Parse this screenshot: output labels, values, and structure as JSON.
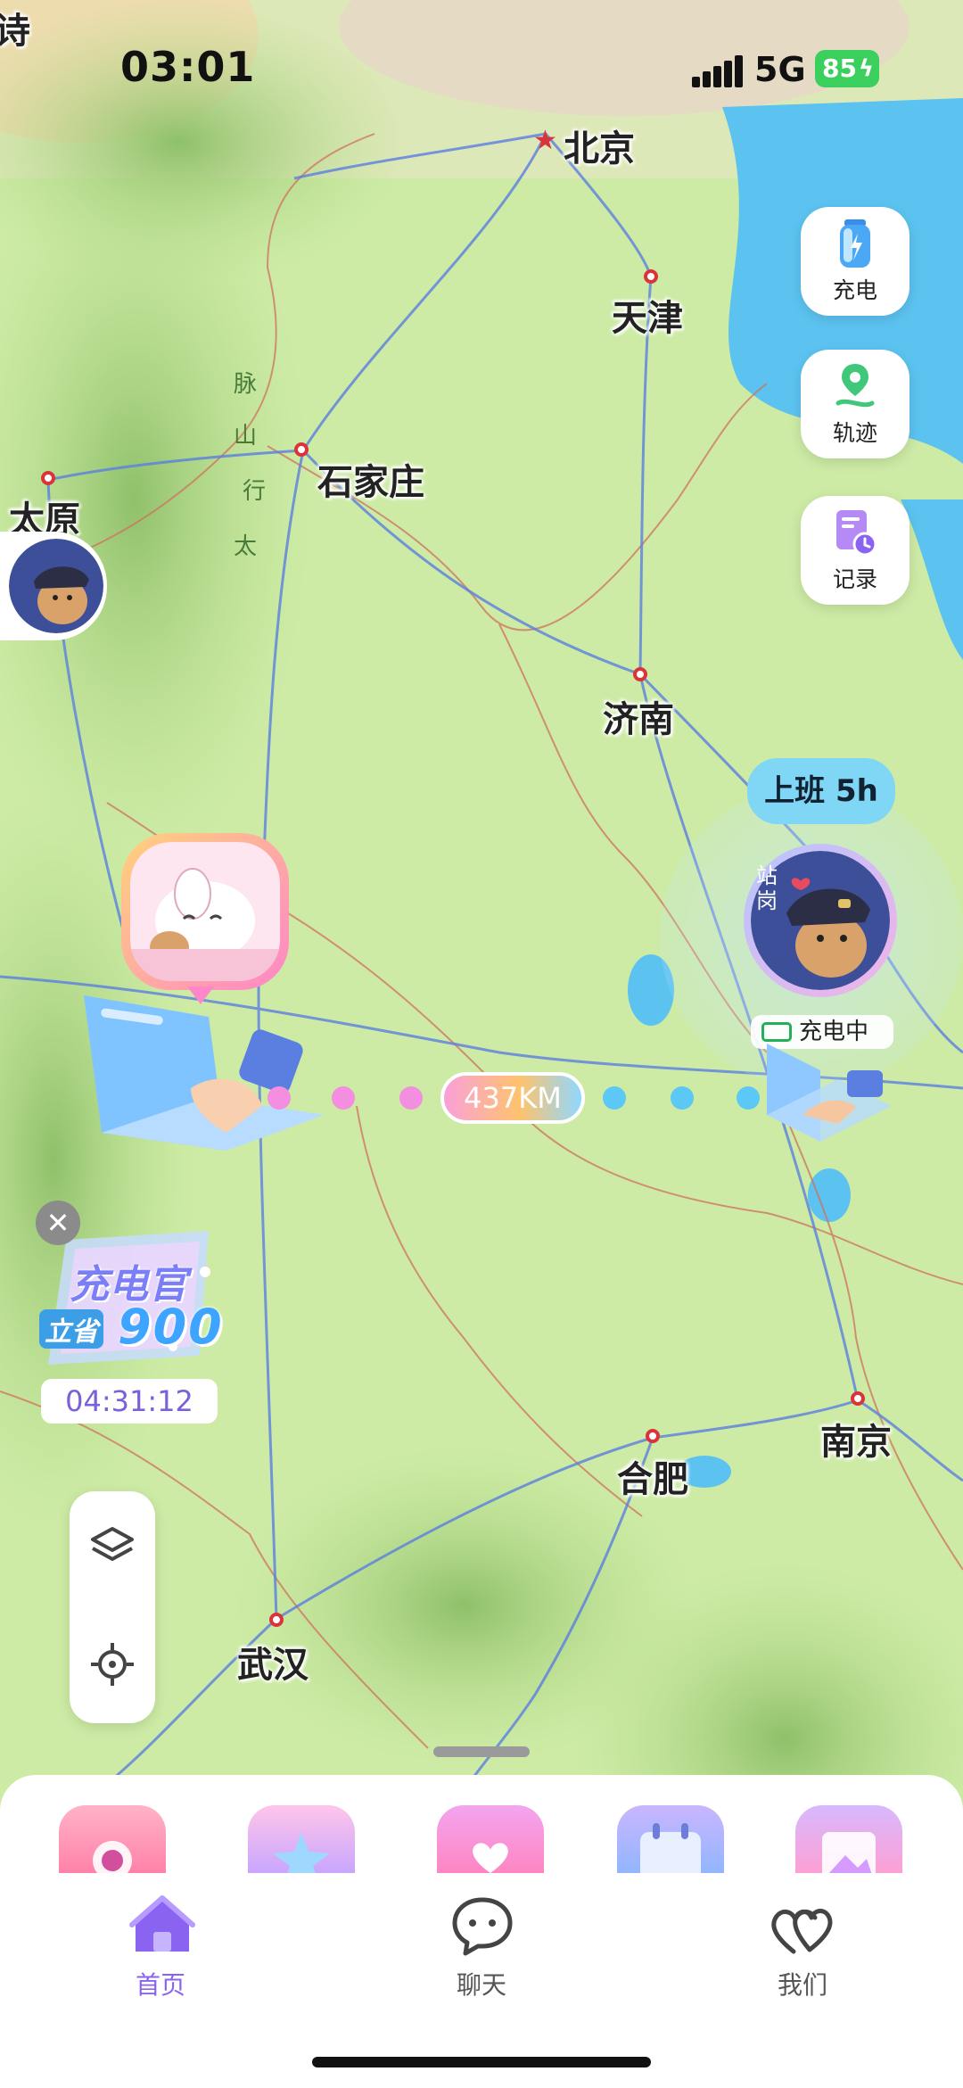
{
  "status_bar": {
    "time": "03:01",
    "network": "5G",
    "battery": "85"
  },
  "map": {
    "cities": [
      {
        "id": "beijing",
        "name": "北京",
        "capital": true
      },
      {
        "id": "tianjin",
        "name": "天津"
      },
      {
        "id": "taiyuan",
        "name": "太原"
      },
      {
        "id": "shijiazhuang",
        "name": "石家庄"
      },
      {
        "id": "jinan",
        "name": "济南"
      },
      {
        "id": "nanjing",
        "name": "南京"
      },
      {
        "id": "hefei",
        "name": "合肥"
      },
      {
        "id": "wuhan",
        "name": "武汉"
      }
    ],
    "mountain_label": [
      "太",
      "行",
      "山",
      "脉"
    ],
    "edge_glyph": "诗"
  },
  "side_buttons": [
    {
      "label": "充电",
      "icon": "charge-icon"
    },
    {
      "label": "轨迹",
      "icon": "track-icon"
    },
    {
      "label": "记录",
      "icon": "record-icon"
    }
  ],
  "partner": {
    "status": "上班 5h",
    "charging": "充电中"
  },
  "distance": "437KM",
  "promo": {
    "title": "充电官",
    "prefix": "立省",
    "amount": "900",
    "countdown": "04:31:12"
  },
  "bottom_apps": [
    "camera-icon",
    "star-icon",
    "heart-card-icon",
    "calendar-icon",
    "photos-icon"
  ],
  "tabs": [
    {
      "label": "首页",
      "icon": "home-icon",
      "active": true
    },
    {
      "label": "聊天",
      "icon": "chat-icon",
      "active": false
    },
    {
      "label": "我们",
      "icon": "hearts-icon",
      "active": false
    }
  ],
  "colors": {
    "accent": "#8a63f0",
    "map_land": "#c9e8a2",
    "sea": "#5cc3f0",
    "city_dot": "#d8343a",
    "road": "#5b7fe0",
    "border": "#d07060"
  }
}
